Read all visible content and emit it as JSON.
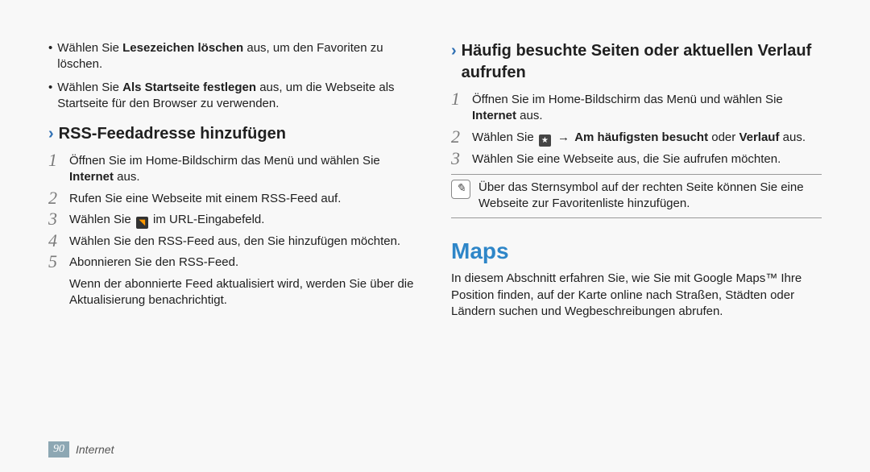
{
  "left": {
    "bullets": [
      {
        "pre": "Wählen Sie ",
        "bold": "Lesezeichen löschen",
        "post": " aus, um den Favoriten zu löschen."
      },
      {
        "pre": "Wählen Sie ",
        "bold": "Als Startseite festlegen",
        "post": " aus, um die Webseite als Startseite für den Browser zu verwenden."
      }
    ],
    "sub_title": "RSS-Feedadresse hinzufügen",
    "steps": [
      {
        "num": "1",
        "pre": "Öffnen Sie im Home-Bildschirm das Menü und wählen Sie ",
        "bold": "Internet",
        "post": " aus."
      },
      {
        "num": "2",
        "text": "Rufen Sie eine Webseite mit einem RSS-Feed auf."
      },
      {
        "num": "3",
        "pre": "Wählen Sie ",
        "icon": "rss",
        "post": " im URL-Eingabefeld."
      },
      {
        "num": "4",
        "text": "Wählen Sie den RSS-Feed aus, den Sie hinzufügen möchten."
      },
      {
        "num": "5",
        "text": "Abonnieren Sie den RSS-Feed."
      }
    ],
    "tail": "Wenn der abonnierte Feed aktualisiert wird, werden Sie über die Aktualisierung benachrichtigt."
  },
  "right": {
    "sub_title": "Häufig besuchte Seiten oder aktuellen Verlauf aufrufen",
    "steps": [
      {
        "num": "1",
        "pre": "Öffnen Sie im Home-Bildschirm das Menü und wählen Sie ",
        "bold": "Internet",
        "post": " aus."
      },
      {
        "num": "2",
        "pre": "Wählen Sie ",
        "icon": "bm",
        "arrow": " → ",
        "bold": "Am häufigsten besucht",
        "mid": " oder ",
        "bold2": "Verlauf",
        "post": " aus."
      },
      {
        "num": "3",
        "text": "Wählen Sie eine Webseite aus, die Sie aufrufen möchten."
      }
    ],
    "note": "Über das Sternsymbol auf der rechten Seite können Sie eine Webseite zur Favoritenliste hinzufügen.",
    "h1": "Maps",
    "intro": "In diesem Abschnitt erfahren Sie, wie Sie mit Google Maps™ Ihre Position finden, auf der Karte online nach Straßen, Städten oder Ländern suchen und Wegbeschreibungen abrufen."
  },
  "footer": {
    "page": "90",
    "text": "Internet"
  },
  "icons": {
    "note": "✎",
    "rss": "◥",
    "bm": "★"
  }
}
